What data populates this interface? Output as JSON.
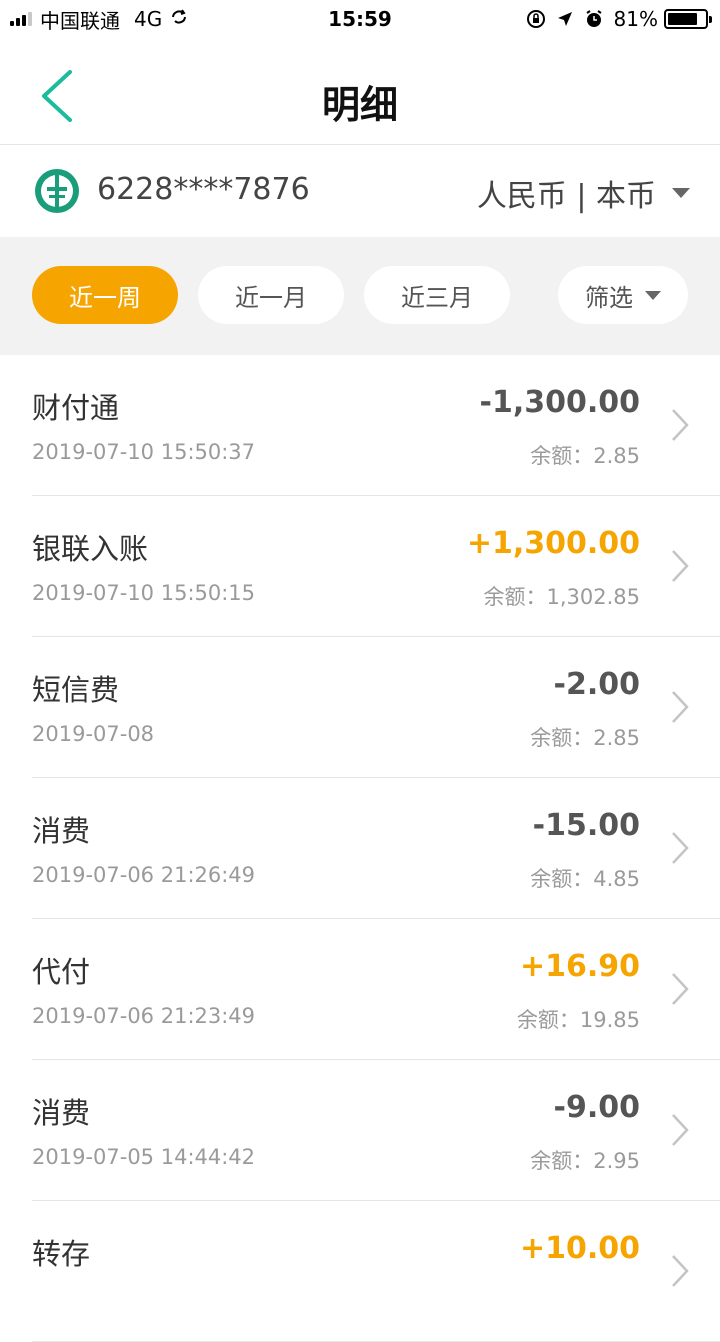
{
  "status_bar": {
    "carrier": "中国联通",
    "network": "4G",
    "time": "15:59",
    "battery_percent": "81%",
    "battery_level": 0.81
  },
  "nav": {
    "title": "明细"
  },
  "account": {
    "number": "6228****7876",
    "currency": "人民币 | 本币"
  },
  "filters": {
    "week": "近一周",
    "month": "近一月",
    "three_months": "近三月",
    "filter": "筛选"
  },
  "transactions": [
    {
      "title": "财付通",
      "time": "2019-07-10 15:50:37",
      "amount": "-1,300.00",
      "balance": "余额：2.85",
      "type": "debit"
    },
    {
      "title": "银联入账",
      "time": "2019-07-10 15:50:15",
      "amount": "+1,300.00",
      "balance": "余额：1,302.85",
      "type": "credit"
    },
    {
      "title": "短信费",
      "time": "2019-07-08",
      "amount": "-2.00",
      "balance": "余额：2.85",
      "type": "debit"
    },
    {
      "title": "消费",
      "time": "2019-07-06 21:26:49",
      "amount": "-15.00",
      "balance": "余额：4.85",
      "type": "debit"
    },
    {
      "title": "代付",
      "time": "2019-07-06 21:23:49",
      "amount": "+16.90",
      "balance": "余额：19.85",
      "type": "credit"
    },
    {
      "title": "消费",
      "time": "2019-07-05 14:44:42",
      "amount": "-9.00",
      "balance": "余额：2.95",
      "type": "debit"
    },
    {
      "title": "转存",
      "time": "",
      "amount": "+10.00",
      "balance": "",
      "type": "credit"
    }
  ],
  "colors": {
    "accent": "#f6a400",
    "back_arrow": "#1abc9c",
    "bank_logo": "#1a9d7a"
  },
  "icons": {
    "back": "back-arrow-icon",
    "logo": "bank-logo-icon",
    "chevron": "chevron-right-icon"
  }
}
